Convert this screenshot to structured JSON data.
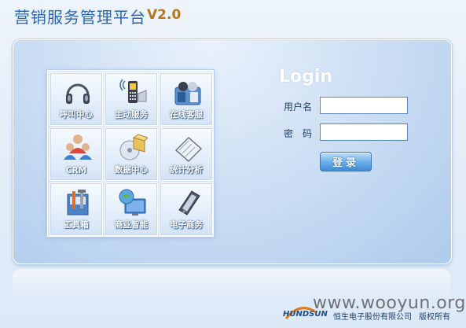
{
  "app": {
    "title": "营销服务管理平台",
    "version": "V2.0"
  },
  "tiles": [
    {
      "label": "呼叫中心",
      "icon": "headset-icon"
    },
    {
      "label": "主动服务",
      "icon": "mobile-phone-icon"
    },
    {
      "label": "在线客服",
      "icon": "online-service-icon"
    },
    {
      "label": "CRM",
      "icon": "users-icon"
    },
    {
      "label": "数据中心",
      "icon": "data-disc-box-icon"
    },
    {
      "label": "统计分析",
      "icon": "notebook-icon"
    },
    {
      "label": "工具箱",
      "icon": "toolbox-icon"
    },
    {
      "label": "商业智能",
      "icon": "globe-monitor-icon"
    },
    {
      "label": "电子商务",
      "icon": "pda-icon"
    }
  ],
  "login": {
    "heading": "Login",
    "username_label": "用户名",
    "username_value": "",
    "password_label": "密　码",
    "password_value": "",
    "submit_label": "登录"
  },
  "footer": {
    "brand": "HUNDSUN",
    "company": "恒生电子股份有限公司",
    "rights": "版权所有",
    "watermark": "www.wooyun.org"
  },
  "colors": {
    "title": "#2a63b0",
    "version": "#b7761a",
    "accent_button": "#3f8bd3",
    "field_border": "#5d87b8"
  }
}
